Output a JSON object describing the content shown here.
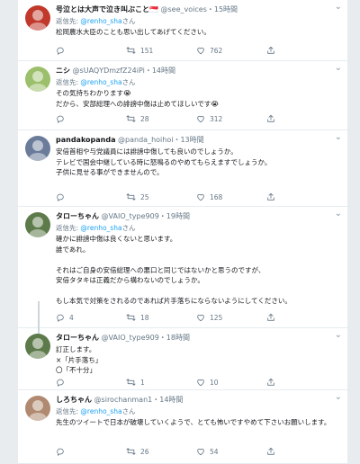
{
  "tweets": [
    {
      "name": "号泣とは大声で泣き叫ぶこと🇸🇬",
      "handle": "@see_voices",
      "time": "15時間",
      "reply_prefix": "返信先: ",
      "reply_mention": "@renho_sha",
      "reply_suffix": "さん",
      "text": "松岡農水大臣のことも思い出してあげてください。",
      "replies": "",
      "retweets": "151",
      "likes": "762",
      "avatar_color": "#c0392b"
    },
    {
      "name": "ニシ",
      "handle": "@sUAQYDmzfZ24iPi",
      "time": "14時間",
      "reply_prefix": "返信先: ",
      "reply_mention": "@renho_sha",
      "reply_suffix": "さん",
      "text": "その気持ちわかります😭\nだから、安部総理への誹謗中傷は止めてほしいです😭",
      "replies": "",
      "retweets": "28",
      "likes": "312",
      "avatar_color": "#9bbf6a"
    },
    {
      "name": "pandakopanda",
      "handle": "@panda_hoihoi",
      "time": "13時間",
      "reply_prefix": "",
      "reply_mention": "",
      "reply_suffix": "",
      "text": "安倍首相や与党議員には誹謗中傷しても良いのでしょうか。\nテレビで国会中継している時に怒鳴るのやめてもらえますでしょうか。\n子供に見せる事ができませんので。",
      "replies": "",
      "retweets": "25",
      "likes": "168",
      "avatar_color": "#6b7b9a"
    },
    {
      "name": "タローちゃん",
      "handle": "@VAIO_type909",
      "time": "19時間",
      "reply_prefix": "返信先: ",
      "reply_mention": "@renho_sha",
      "reply_suffix": "さん",
      "text": "確かに誹謗中傷は良くないと思います。\n誰であれ。\n\nそれはご自身の安倍総理への悪口と同じではないかと思うのですが、\n安倍タタキは正義だから構わないのでしょうか。\n\nもし本気で対策をされるのであれば片手落ちにならないようにしてください。",
      "replies": "4",
      "retweets": "18",
      "likes": "125",
      "avatar_color": "#5d7a4a"
    },
    {
      "name": "タローちゃん",
      "handle": "@VAIO_type909",
      "time": "18時間",
      "reply_prefix": "",
      "reply_mention": "",
      "reply_suffix": "",
      "text": "訂正します。\n×「片手落ち」\n〇「不十分」",
      "replies": "",
      "retweets": "1",
      "likes": "10",
      "avatar_color": "#5d7a4a"
    },
    {
      "name": "しろちゃん",
      "handle": "@sirochanman1",
      "time": "14時間",
      "reply_prefix": "返信先: ",
      "reply_mention": "@renho_sha",
      "reply_suffix": "さん",
      "text": "先生のツイートで日本が破壊していくようで、とても怖いですやめて下さいお願いします。",
      "replies": "",
      "retweets": "26",
      "likes": "54",
      "avatar_color": "#b08a70"
    }
  ],
  "icons": {
    "reply": "reply-icon",
    "retweet": "retweet-icon",
    "like": "heart-icon",
    "share": "share-icon",
    "more": "chevron-down-icon"
  }
}
